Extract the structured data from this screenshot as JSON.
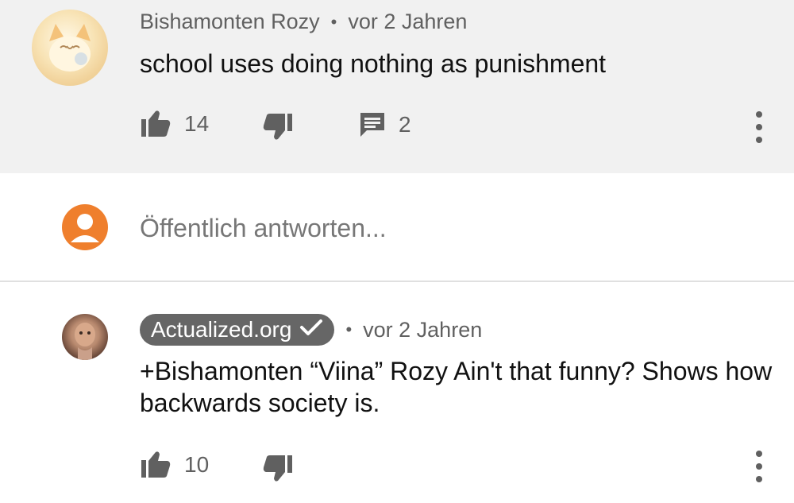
{
  "comments": [
    {
      "author": "Bishamonten Rozy",
      "time": "vor 2 Jahren",
      "text": "school uses doing nothing as punishment",
      "likes": "14",
      "replies": "2",
      "avatar_icon": "anime-cat-avatar"
    },
    {
      "author": "Actualized.org",
      "verified": true,
      "time": "vor 2 Jahren",
      "text": "+Bishamonten “Viina” Rozy Ain't that funny? Shows how backwards society is.",
      "likes": "10",
      "avatar_icon": "man-portrait-avatar"
    }
  ],
  "reply": {
    "placeholder": "Öffentlich antworten..."
  },
  "icons": {
    "like": "thumbs-up-icon",
    "dislike": "thumbs-down-icon",
    "reply": "comment-icon",
    "more": "more-vert-icon",
    "verified": "check-icon",
    "user": "account-circle-icon"
  },
  "colors": {
    "top_bg": "#f1f1f1",
    "meta_text": "#606060",
    "user_avatar": "#ef7f2d",
    "badge_bg": "#666666"
  }
}
